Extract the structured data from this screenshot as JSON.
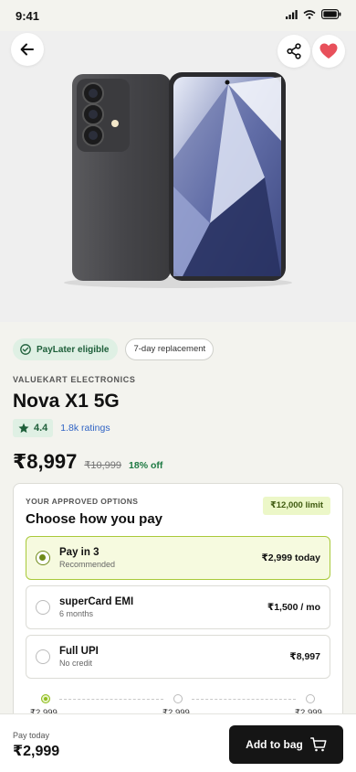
{
  "status_bar": {
    "time": "9:41"
  },
  "badges": {
    "paylater": "PayLater eligible",
    "replacement": "7-day replacement"
  },
  "product": {
    "seller": "VALUEKART ELECTRONICS",
    "title": "Nova X1 5G",
    "rating": "4.4",
    "ratings_count": "1.8k ratings",
    "price": "₹8,997",
    "mrp": "₹10,999",
    "discount": "18% off"
  },
  "payment": {
    "eyebrow": "YOUR APPROVED OPTIONS",
    "title": "Choose how you pay",
    "limit": "₹12,000 limit",
    "options": [
      {
        "title": "Pay in 3",
        "sub": "Recommended",
        "amount": "₹2,999 today",
        "selected": true
      },
      {
        "title": "superCard EMI",
        "sub": "6 months",
        "amount": "₹1,500 / mo",
        "selected": false
      },
      {
        "title": "Full UPI",
        "sub": "No credit",
        "amount": "₹8,997",
        "selected": false
      }
    ],
    "schedule": [
      "₹2,999",
      "₹2,999",
      "₹2,999"
    ]
  },
  "footer": {
    "pay_today_label": "Pay today",
    "pay_today_amount": "₹2,999",
    "cta": "Add to bag"
  },
  "colors": {
    "accent_green": "#1e7a43",
    "lime": "#a9c93b",
    "heart": "#e8505b",
    "cta_bg": "#151515"
  }
}
